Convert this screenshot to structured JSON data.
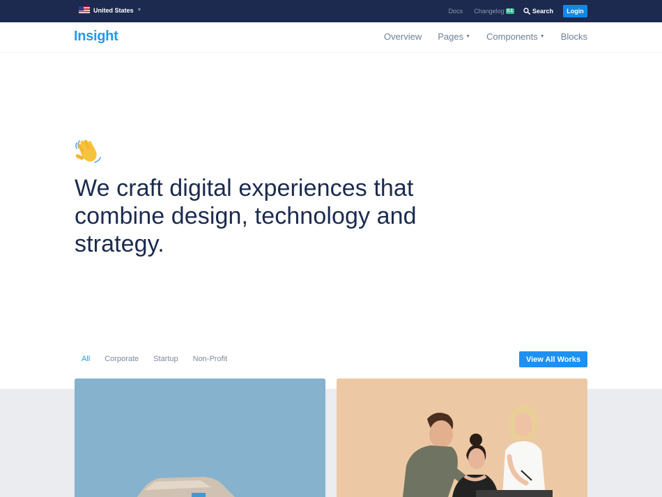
{
  "topbar": {
    "country": "United States",
    "links": {
      "docs": "Docs",
      "changelog": "Changelog",
      "changelog_badge": "0.1",
      "search": "Search"
    },
    "login": "Login"
  },
  "navbar": {
    "brand": "Insight",
    "items": [
      {
        "label": "Overview"
      },
      {
        "label": "Pages"
      },
      {
        "label": "Components"
      },
      {
        "label": "Blocks"
      }
    ]
  },
  "hero": {
    "emoji": "waving-hand",
    "title": "We craft digital experiences that combine design, technology and strategy."
  },
  "works": {
    "filters": [
      {
        "label": "All"
      },
      {
        "label": "Corporate"
      },
      {
        "label": "Startup"
      },
      {
        "label": "Non-Profit"
      }
    ],
    "view_all": "View All Works"
  },
  "colors": {
    "topbar_bg": "#1b2a4e",
    "brand": "#1f9bf0",
    "primary_button": "#1e90f2",
    "badge": "#42ba96",
    "heading": "#1b2a4e"
  }
}
